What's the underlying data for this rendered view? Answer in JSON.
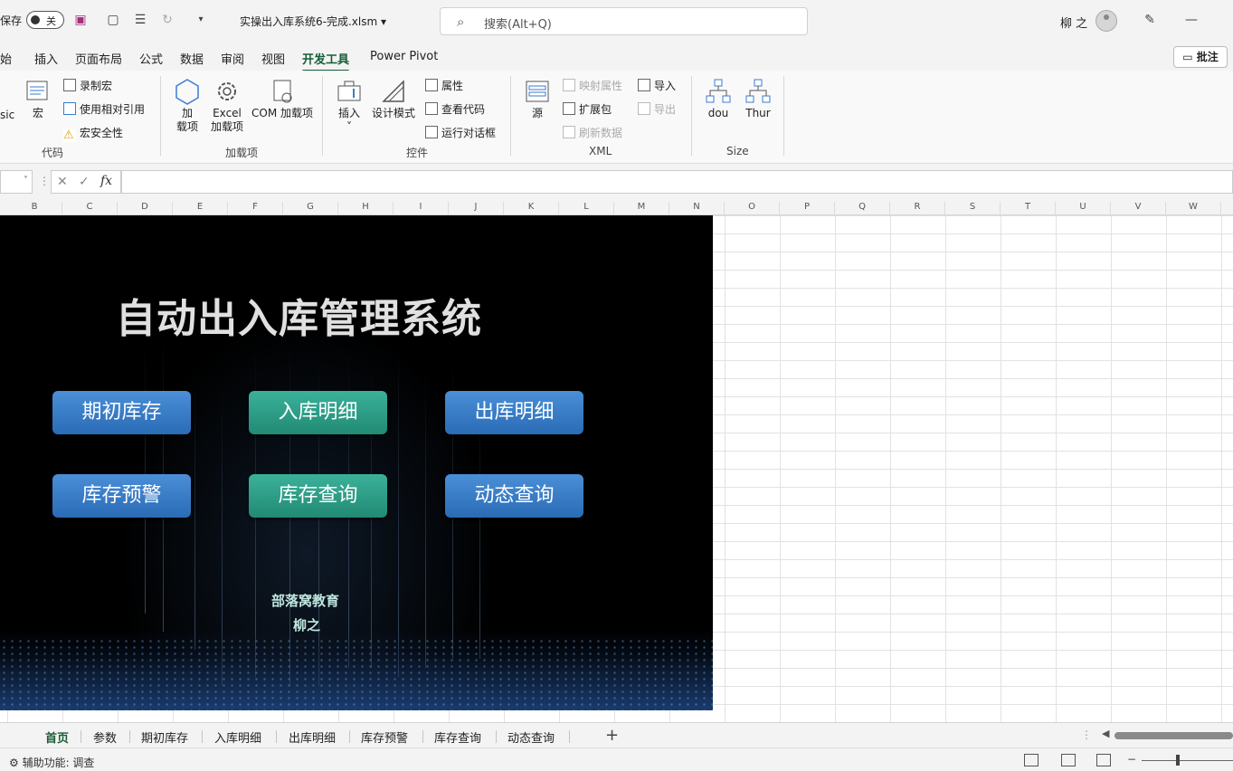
{
  "titlebar": {
    "autosave_label": "保存",
    "autosave_state": "关",
    "filename": "实操出入库系统6-完成.xlsm",
    "search_placeholder": "搜索(Alt+Q)",
    "user_name": "柳 之"
  },
  "ribbon_tabs": [
    "开始",
    "插入",
    "页面布局",
    "公式",
    "数据",
    "审阅",
    "视图",
    "开发工具",
    "Power Pivot"
  ],
  "ribbon_tabs_visible": [
    "开始",
    "插入",
    "页面布局",
    "公式",
    "数据",
    "审阅",
    "视图",
    "开发工具",
    "Power Pivot"
  ],
  "ribbon_tab_display": [
    "始",
    "插入",
    "页面布局",
    "公式",
    "数据",
    "审阅",
    "视图",
    "开发工具",
    "Power Pivot"
  ],
  "active_tab": "开发工具",
  "comment_button": "批注",
  "ribbon": {
    "code": {
      "label": "代码",
      "basic": "sic",
      "macro": "宏",
      "record_macro": "录制宏",
      "relative_ref": "使用相对引用",
      "macro_security": "宏安全性"
    },
    "addins": {
      "label": "加载项",
      "addin_line1": "加",
      "addin_line2": "载项",
      "excel_addin_line1": "Excel",
      "excel_addin_line2": "加载项",
      "com_addin": "COM 加载项"
    },
    "controls": {
      "label": "控件",
      "insert": "插入",
      "design_mode": "设计模式",
      "properties": "属性",
      "view_code": "查看代码",
      "run_dialog": "运行对话框"
    },
    "xml": {
      "label": "XML",
      "source": "源",
      "map_properties": "映射属性",
      "expansion_packs": "扩展包",
      "refresh_data": "刷新数据",
      "import": "导入",
      "export": "导出"
    },
    "size": {
      "label": "Size",
      "dou": "dou",
      "thur": "Thur"
    }
  },
  "formula_bar": {
    "fx": "fx",
    "cancel": "✕",
    "enter": "✓"
  },
  "columns": [
    "B",
    "C",
    "D",
    "E",
    "F",
    "G",
    "H",
    "I",
    "J",
    "K",
    "L",
    "M",
    "N",
    "O",
    "P",
    "Q",
    "R",
    "S",
    "T",
    "U",
    "V",
    "W"
  ],
  "banner": {
    "title": "自动出入库管理系统",
    "buttons": [
      {
        "label": "期初库存",
        "color": "blue"
      },
      {
        "label": "入库明细",
        "color": "green"
      },
      {
        "label": "出库明细",
        "color": "blue"
      },
      {
        "label": "库存预警",
        "color": "blue"
      },
      {
        "label": "库存查询",
        "color": "green"
      },
      {
        "label": "动态查询",
        "color": "blue"
      }
    ],
    "credit_line1": "部落窝教育",
    "credit_line2": "柳之"
  },
  "sheet_tabs": [
    "首页",
    "参数",
    "期初库存",
    "入库明细",
    "出库明细",
    "库存预警",
    "库存查询",
    "动态查询"
  ],
  "active_sheet": "首页",
  "statusbar": {
    "accessibility": "辅助功能: 调查"
  }
}
